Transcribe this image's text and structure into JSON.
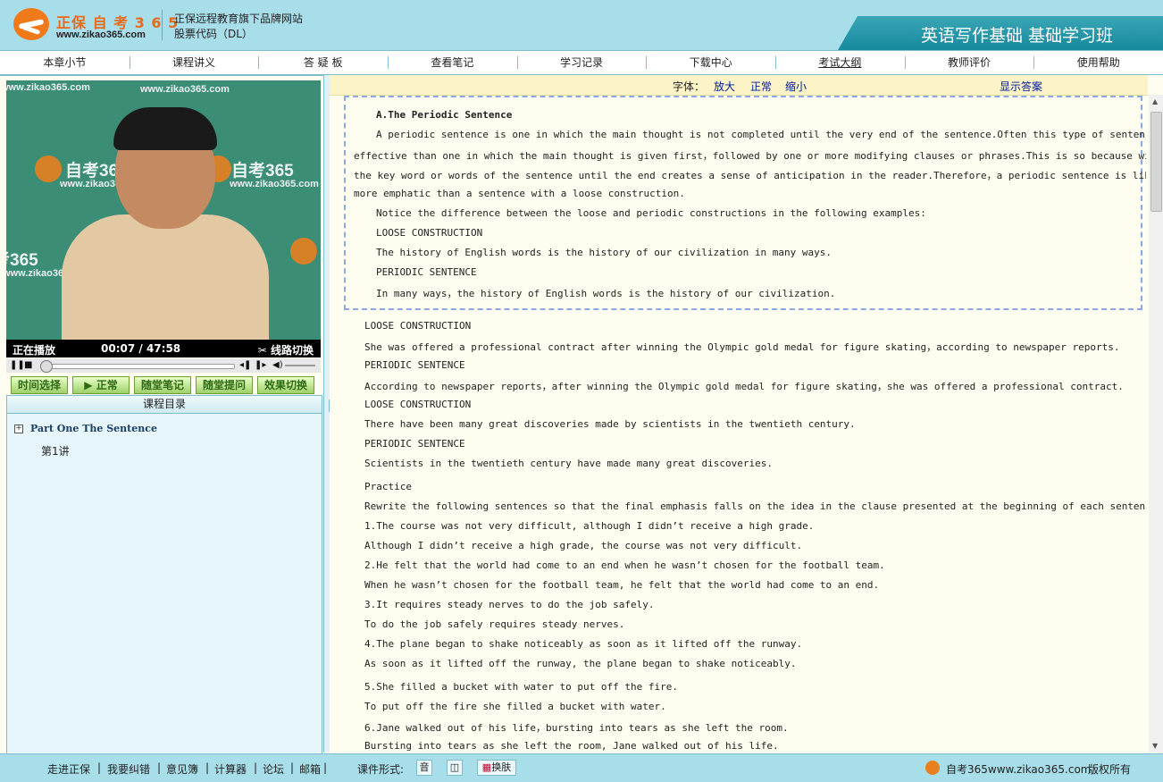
{
  "header": {
    "logo_cn": "正保 自 考 3 6 5",
    "logo_url": "www.zikao365.com",
    "brand_line1": "正保远程教育旗下品牌网站",
    "brand_line2": "股票代码（DL）",
    "course_title": "英语写作基础 基础学习班"
  },
  "nav": [
    {
      "label": "本章小节"
    },
    {
      "label": "课程讲义"
    },
    {
      "label": "答 疑 板"
    },
    {
      "label": "查看笔记"
    },
    {
      "label": "学习记录"
    },
    {
      "label": "下载中心"
    },
    {
      "label": "考试大纲"
    },
    {
      "label": "教师评价"
    },
    {
      "label": "使用帮助"
    }
  ],
  "video": {
    "watermark_small": "www.zikao365.com",
    "watermark_big": "自考365",
    "status": "正在播放",
    "current_time": "00:07",
    "duration": "47:58",
    "line_switch": "线路切换",
    "progress": 0.01
  },
  "player_buttons": [
    "时间选择",
    "正常",
    "随堂笔记",
    "随堂提问",
    "效果切换"
  ],
  "toc": {
    "header": "课程目录",
    "part": "Part One The Sentence",
    "lesson": "第1讲"
  },
  "font_bar": {
    "label": "字体：",
    "enlarge": "放大",
    "normal": "正常",
    "shrink": "缩小",
    "show_answer": "显示答案"
  },
  "content": {
    "intro_title": "A.The Periodic Sentence",
    "intro_lines": [
      "A periodic sentence is one in which the main thought is not completed until the very end of the sentence.Often this type of sentence is more",
      "effective than one in which the main thought is given first，followed by one or more modifying clauses or phrases.This is so because withholding",
      "the key word or words of the sentence until the end creates a sense of anticipation in the reader.Therefore，a periodic sentence is likely to be",
      "more emphatic than a sentence with a loose construction.",
      "Notice the difference between the loose and periodic constructions in the following examples:",
      "LOOSE CONSTRUCTION",
      "The history of English words is the history of our civilization in many ways.",
      "PERIODIC SENTENCE",
      "In many ways，the history of English words is the history of our civilization."
    ],
    "body_lines": [
      "LOOSE CONSTRUCTION",
      "She was offered a professional contract after winning the Olympic gold medal for figure skating，according to newspaper reports.",
      "PERIODIC SENTENCE",
      "According to newspaper reports，after winning the Olympic gold medal for figure skating，she was offered a professional contract.",
      "LOOSE CONSTRUCTION",
      "There have been many great discoveries made by scientists in the twentieth century.",
      "PERIODIC SENTENCE",
      "Scientists in the twentieth century have made many great discoveries.",
      "Practice",
      "Rewrite the following sentences so that the final emphasis falls on the idea in the clause presented at the beginning of each sentence.",
      "1.The course was not very difficult, although I didn’t receive a high grade.",
      "Although I didn’t receive a high grade, the course was not very difficult.",
      "2.He felt that the world had come to an end when he wasn’t chosen for the football team.",
      "When he wasn’t chosen for the football team, he felt that the world had come to an end.",
      "3.It requires steady nerves to do the job safely.",
      "To do the job safely requires steady nerves.",
      "4.The plane began to shake noticeably as soon as it lifted off the runway.",
      "As soon as it lifted off the runway, the plane began to shake noticeably.",
      "5.She filled a bucket with water to put off the fire.",
      "To put off the fire she filled a bucket with water.",
      "6.Jane walked out of his life，bursting into tears as she left the room.",
      "Bursting into tears as she left the room, Jane walked out of his life."
    ]
  },
  "footer": {
    "links": [
      "走进正保",
      "我要纠错",
      "意见簿",
      "计算器",
      "论坛",
      "邮箱"
    ],
    "format_label": "课件形式:",
    "format_audio": "音",
    "skin": "换肤",
    "site": "自考365www.zikao365.com",
    "copyright": "版权所有"
  },
  "colors": {
    "header_bg": "#a8ddea",
    "banner": "#168a9d",
    "link": "#001a99",
    "player_button": "#9fd06a"
  }
}
